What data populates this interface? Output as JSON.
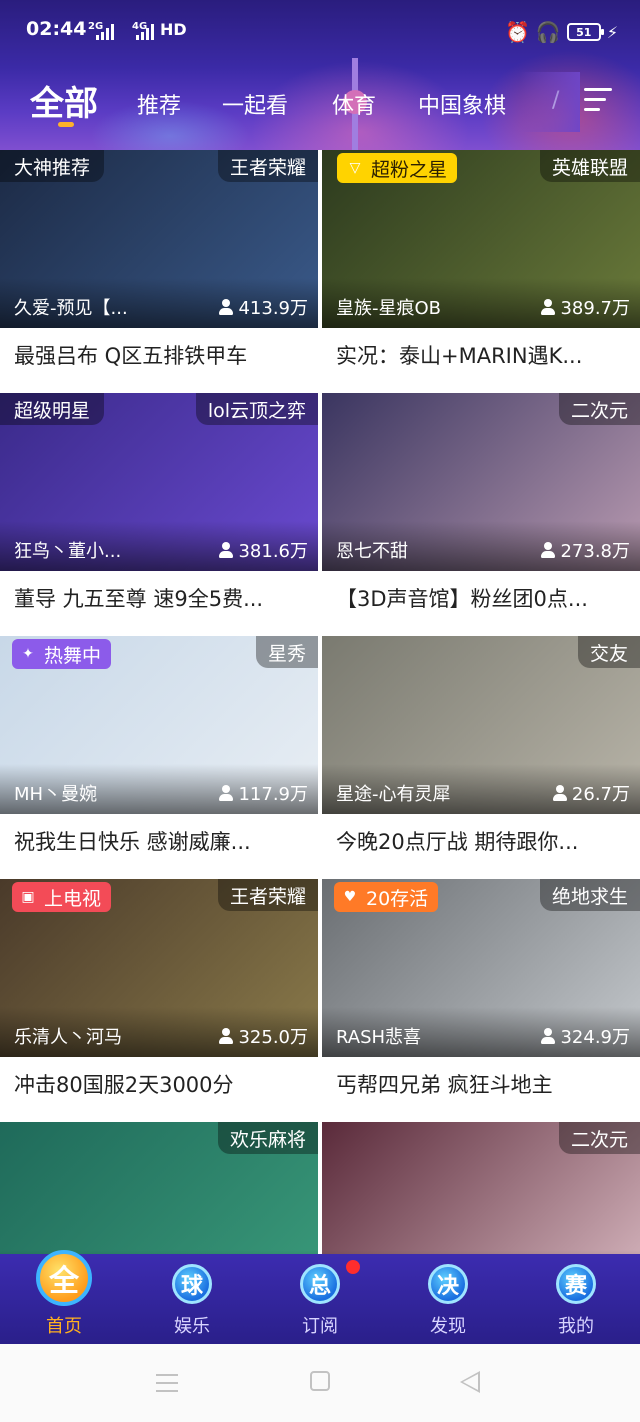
{
  "status_bar": {
    "time": "02:44",
    "sim1": "2G",
    "sim2": "4G",
    "network": "HD",
    "battery": "51"
  },
  "tabs": [
    {
      "label": "全部",
      "active": true
    },
    {
      "label": "推荐",
      "active": false
    },
    {
      "label": "一起看",
      "active": false
    },
    {
      "label": "体育",
      "active": false
    },
    {
      "label": "中国象棋",
      "active": false
    },
    {
      "label": "/",
      "active": false
    }
  ],
  "colors": {
    "header_top": "#2a1d7e",
    "accent_orange": "#ffb22b",
    "nav_bg": "#3c2cb0"
  },
  "cards": [
    {
      "tag_left": "大神推荐",
      "tag_style": "plain",
      "tag_right": "王者荣耀",
      "streamer": "久爱-预见【...",
      "viewers": "413.9万",
      "title": "最强吕布 Q区五排铁甲车",
      "thumb": [
        "#1c2a45",
        "#3a5a8a"
      ]
    },
    {
      "tag_left": "超粉之星",
      "tag_style": "yellow",
      "tag_icon": "▽",
      "tag_right": "英雄联盟",
      "streamer": "皇族-星痕OB",
      "viewers": "389.7万",
      "title": "实况：泰山+MARIN遇K...",
      "thumb": [
        "#2c3a1e",
        "#6a7a3a"
      ]
    },
    {
      "tag_left": "超级明星",
      "tag_style": "plain",
      "tag_right": "lol云顶之弈",
      "streamer": "狂鸟丶董小...",
      "viewers": "381.6万",
      "title": "董导 九五至尊 速9全5费...",
      "thumb": [
        "#3a2a8a",
        "#6a4ad0"
      ]
    },
    {
      "tag_left": "",
      "tag_style": "none",
      "tag_right": "二次元",
      "streamer": "恩七不甜",
      "viewers": "273.8万",
      "title": "【3D声音馆】粉丝团0点...",
      "thumb": [
        "#3a3560",
        "#b89ab0"
      ]
    },
    {
      "tag_left": "热舞中",
      "tag_style": "purple",
      "tag_icon": "✦",
      "tag_right": "星秀",
      "streamer": "MH丶曼婉",
      "viewers": "117.9万",
      "title": "祝我生日快乐 感谢威廉...",
      "thumb": [
        "#c8d8e8",
        "#e8eef4"
      ]
    },
    {
      "tag_left": "",
      "tag_style": "none",
      "tag_right": "交友",
      "streamer": "星途-心有灵犀",
      "viewers": "26.7万",
      "title": "今晚20点厅战 期待跟你...",
      "thumb": [
        "#7a7a70",
        "#b8b4a8"
      ]
    },
    {
      "tag_left": "上电视",
      "tag_style": "red",
      "tag_icon": "▣",
      "tag_right": "王者荣耀",
      "streamer": "乐清人丶河马",
      "viewers": "325.0万",
      "title": "冲击80国服2天3000分",
      "thumb": [
        "#4a3a2a",
        "#8a7a4a"
      ]
    },
    {
      "tag_left": "20存活",
      "tag_style": "orange",
      "tag_icon": "♥",
      "tag_right": "绝地求生",
      "streamer": "RASH悲喜",
      "viewers": "324.9万",
      "title": "丐帮四兄弟 疯狂斗地主",
      "thumb": [
        "#6a6e72",
        "#c4c8cc"
      ]
    },
    {
      "tag_left": "",
      "tag_style": "none",
      "tag_right": "欢乐麻将",
      "streamer": "",
      "viewers": "",
      "title": "",
      "thumb": [
        "#1f6a5a",
        "#3a9a7a"
      ]
    },
    {
      "tag_left": "",
      "tag_style": "none",
      "tag_right": "二次元",
      "streamer": "",
      "viewers": "",
      "title": "",
      "thumb": [
        "#5a2a3a",
        "#d8b8c0"
      ]
    }
  ],
  "bottom_nav": [
    {
      "icon_char": "全",
      "label": "首页",
      "icon_name": "home-icon",
      "active": true,
      "badge": false
    },
    {
      "icon_char": "球",
      "label": "娱乐",
      "icon_name": "entertainment-icon",
      "active": false,
      "badge": false
    },
    {
      "icon_char": "总",
      "label": "订阅",
      "icon_name": "subscribe-icon",
      "active": false,
      "badge": true
    },
    {
      "icon_char": "决",
      "label": "发现",
      "icon_name": "discover-icon",
      "active": false,
      "badge": false
    },
    {
      "icon_char": "赛",
      "label": "我的",
      "icon_name": "profile-icon",
      "active": false,
      "badge": false
    }
  ]
}
